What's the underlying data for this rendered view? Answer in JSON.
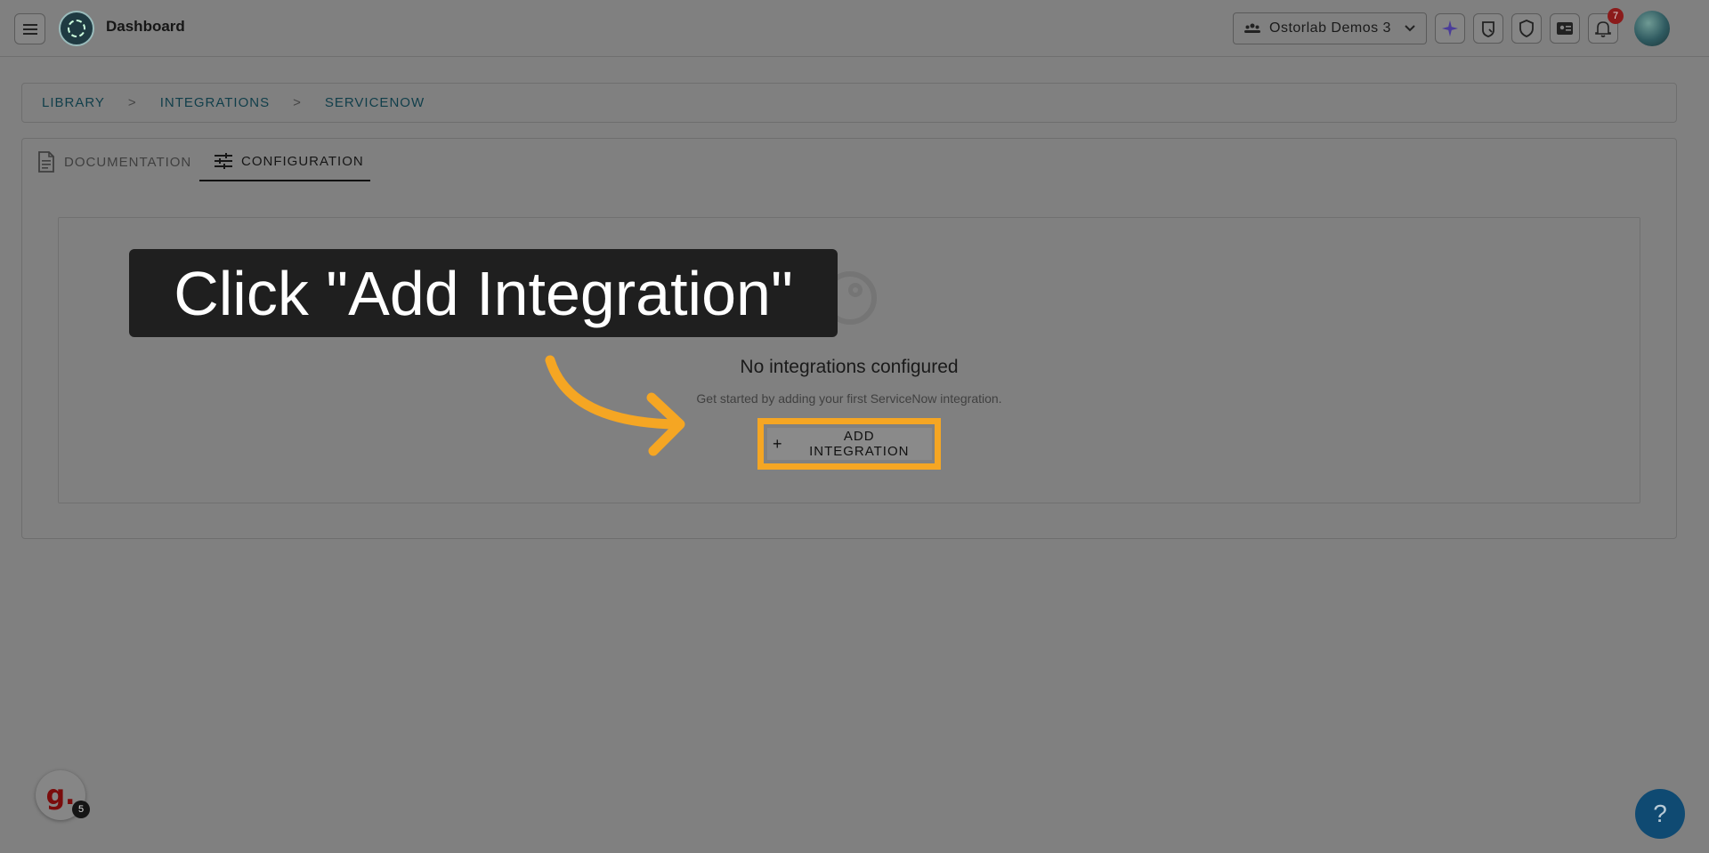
{
  "header": {
    "app_title": "Dashboard",
    "org_name": "Ostorlab Demos 3",
    "notification_count": "7",
    "icons": [
      "menu-icon",
      "ostorlab-logo",
      "team-icon",
      "chevron-down-icon",
      "sparkle-icon",
      "refresh-shield-icon",
      "shield-icon",
      "id-card-icon",
      "bell-icon",
      "user-avatar"
    ],
    "colors": {
      "sparkle": "#4a3c9a",
      "badge": "#8b1b1b"
    }
  },
  "breadcrumb": {
    "items": [
      "LIBRARY",
      "INTEGRATIONS",
      "SERVICENOW"
    ],
    "separator": ">"
  },
  "tabs": [
    {
      "label": "DOCUMENTATION",
      "icon": "document-icon",
      "active": false
    },
    {
      "label": "CONFIGURATION",
      "icon": "sliders-icon",
      "active": true
    }
  ],
  "empty_state": {
    "title": "No integrations configured",
    "subtitle": "Get started by adding your first ServiceNow integration.",
    "button_label": "ADD INTEGRATION",
    "button_icon": "plus-icon"
  },
  "annotation": {
    "text": "Click \"Add Integration\"",
    "highlight_color": "#f5a623"
  },
  "widgets": {
    "gist_letter": "g.",
    "gist_count": "5",
    "help_label": "?",
    "help_color": "#0f4a72"
  }
}
